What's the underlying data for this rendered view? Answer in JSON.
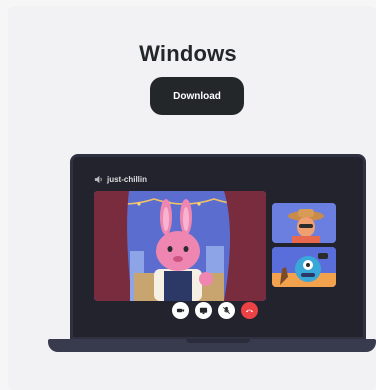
{
  "platform": {
    "title": "Windows",
    "download_label": "Download"
  },
  "call": {
    "channel_name": "just-chillin",
    "icons": {
      "channel": "speaker-icon",
      "controls": [
        "camera-icon",
        "screen-share-icon",
        "mute-icon",
        "hangup-icon"
      ]
    }
  },
  "colors": {
    "background": "#f2f2f4",
    "button": "#23272a",
    "laptop_screen": "#23232e",
    "laptop_base": "#383a4e",
    "hangup": "#ed4245",
    "video_bg": "#5b6ecf"
  }
}
